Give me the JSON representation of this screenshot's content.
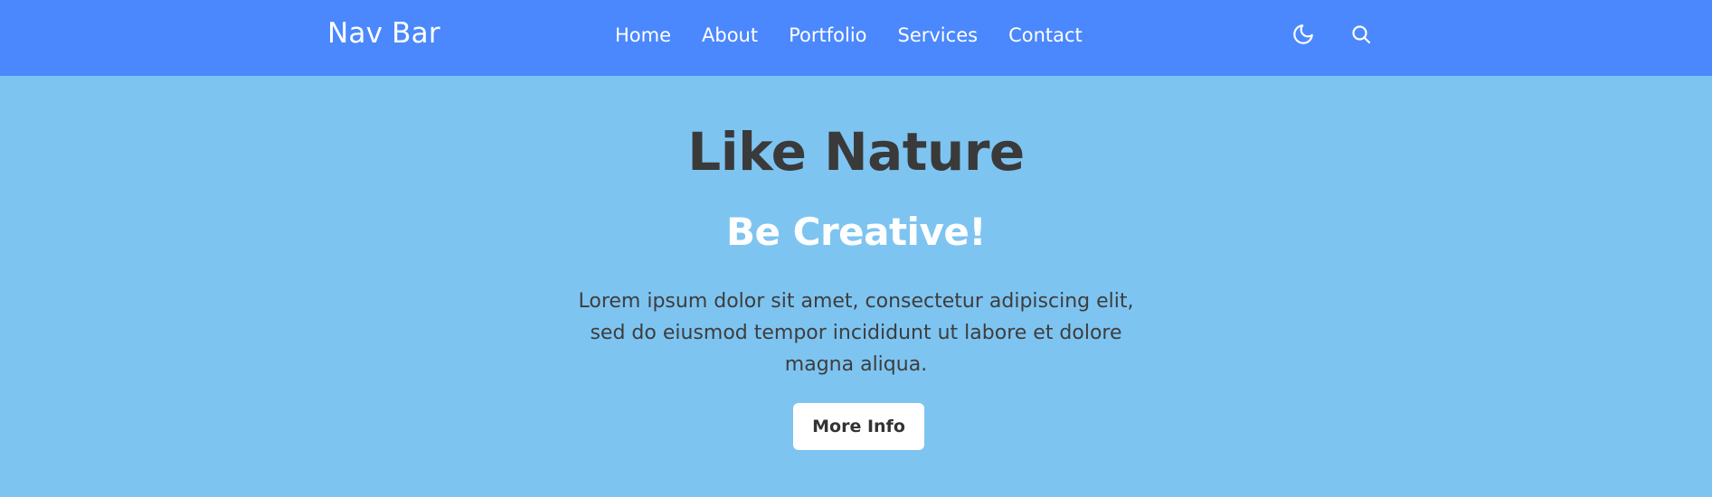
{
  "navbar": {
    "brand": "Nav Bar",
    "links": [
      {
        "label": "Home"
      },
      {
        "label": "About"
      },
      {
        "label": "Portfolio"
      },
      {
        "label": "Services"
      },
      {
        "label": "Contact"
      }
    ],
    "icons": [
      "moon-icon",
      "search-icon"
    ]
  },
  "hero": {
    "title": "Like Nature",
    "subtitle": "Be Creative!",
    "text": "Lorem ipsum dolor sit amet, consectetur adipiscing elit, sed do eiusmod tempor incididunt ut labore et dolore magna aliqua.",
    "button_label": "More Info"
  },
  "colors": {
    "navbar_bg": "#4b88fd",
    "page_bg": "#7ec4f1",
    "title_text": "#3a3a3a",
    "subtitle_text": "#ffffff",
    "button_bg": "#ffffff"
  }
}
